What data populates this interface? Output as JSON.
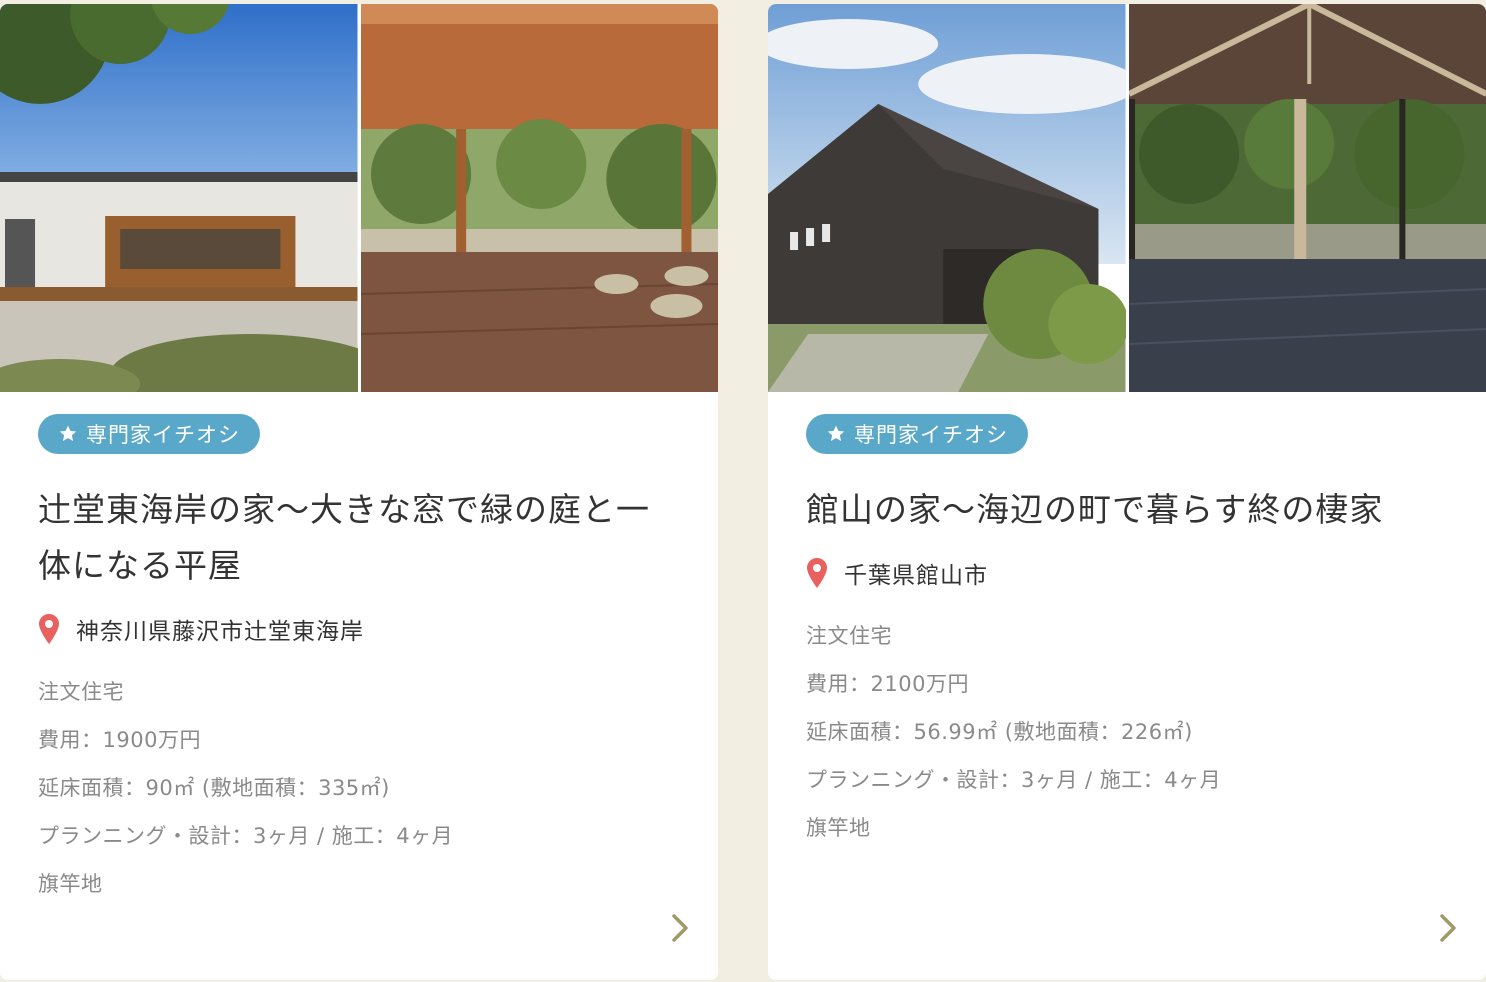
{
  "cards": [
    {
      "badge": "専門家イチオシ",
      "title": "辻堂東海岸の家〜大きな窓で緑の庭と一体になる平屋",
      "location": "神奈川県藤沢市辻堂東海岸",
      "type": "注文住宅",
      "cost": "費用：1900万円",
      "area": "延床面積：90㎡ (敷地面積：335㎡)",
      "period": "プランニング・設計：3ヶ月 / 施工：4ヶ月",
      "land": "旗竿地"
    },
    {
      "badge": "専門家イチオシ",
      "title": "館山の家〜海辺の町で暮らす終の棲家",
      "location": "千葉県館山市",
      "type": "注文住宅",
      "cost": "費用：2100万円",
      "area": "延床面積：56.99㎡ (敷地面積：226㎡)",
      "period": "プランニング・設計：3ヶ月 / 施工：4ヶ月",
      "land": "旗竿地"
    }
  ],
  "icons": {
    "badge": "star-icon",
    "location": "map-pin-icon",
    "more": "chevron-right-icon"
  },
  "colors": {
    "badge": "#59a8c9",
    "pin": "#e8615f",
    "chevron": "#a09a6a",
    "background": "#f2efe2"
  }
}
